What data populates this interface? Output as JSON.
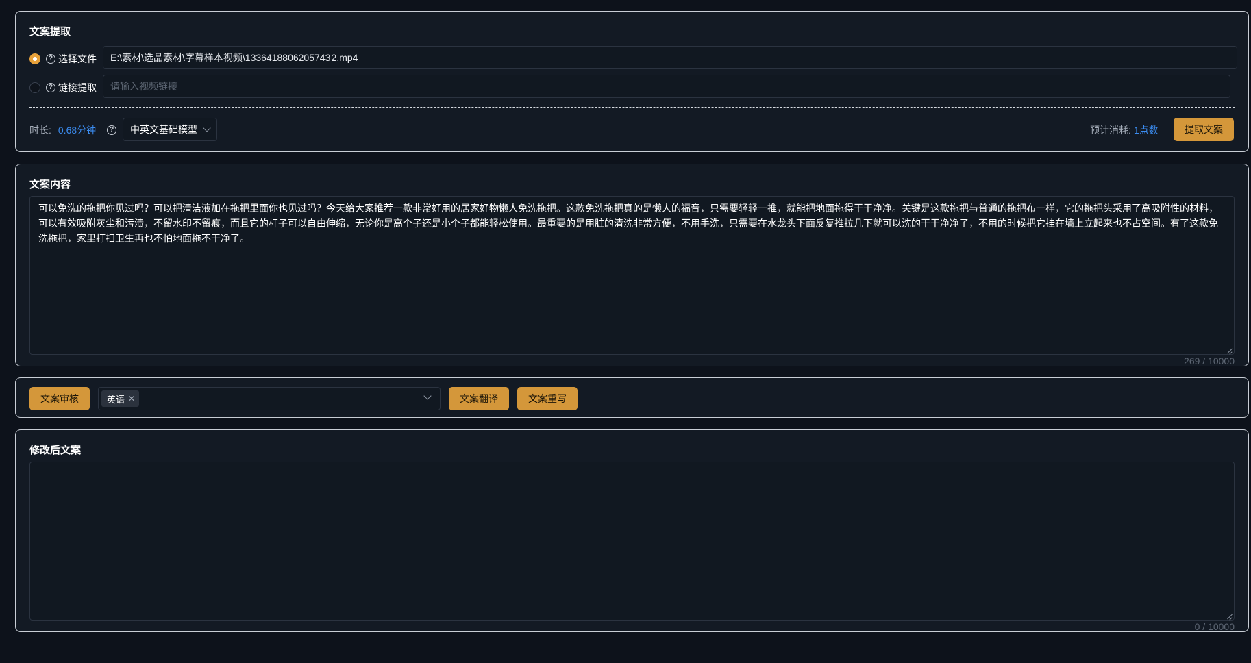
{
  "extract": {
    "title": "文案提取",
    "option_file_label": "选择文件",
    "option_file_value": "E:\\素材\\选品素材\\字幕样本视频\\1336418806205743 2.mp4",
    "option_link_label": "链接提取",
    "option_link_placeholder": "请输入视频链接",
    "duration_label": "时长:",
    "duration_value": "0.68分钟",
    "model_select": "中英文基础模型",
    "cost_label": "预计消耗:",
    "cost_value": "1点数",
    "extract_button": "提取文案"
  },
  "content": {
    "title": "文案内容",
    "text": "可以免洗的拖把你见过吗？可以把清洁液加在拖把里面你也见过吗？今天给大家推荐一款非常好用的居家好物懒人免洗拖把。这款免洗拖把真的是懒人的福音，只需要轻轻一推，就能把地面拖得干干净净。关键是这款拖把与普通的拖把布一样，它的拖把头采用了高吸附性的材料，可以有效吸附灰尘和污渍，不留水印不留痕，而且它的杆子可以自由伸缩，无论你是高个子还是小个子都能轻松使用。最重要的是用脏的清洗非常方便，不用手洗，只需要在水龙头下面反复推拉几下就可以洗的干干净净了，不用的时候把它挂在墙上立起来也不占空间。有了这款免洗拖把，家里打扫卫生再也不怕地面拖不干净了。",
    "counter": "269 / 10000"
  },
  "tools": {
    "review_button": "文案审核",
    "language_tag": "英语",
    "translate_button": "文案翻译",
    "rewrite_button": "文案重写"
  },
  "rewrite": {
    "title": "修改后文案",
    "text": "",
    "counter": "0 / 10000"
  }
}
